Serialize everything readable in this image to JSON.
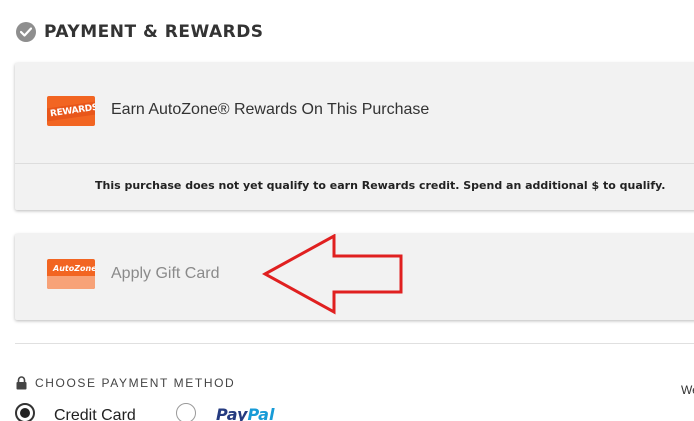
{
  "section": {
    "title": "PAYMENT & REWARDS"
  },
  "rewards": {
    "logo_text": "REWARDS",
    "title": "Earn AutoZone® Rewards On This Purchase",
    "note": "This purchase does not yet qualify to earn Rewards credit. Spend an additional $ to qualify."
  },
  "gift_card": {
    "logo_text": "AutoZone",
    "label": "Apply Gift Card"
  },
  "payment_method": {
    "header": "CHOOSE PAYMENT METHOD",
    "right_text": "We",
    "options": [
      {
        "label": "Credit Card",
        "selected": true
      },
      {
        "label": "PayPal",
        "pay": "Pay",
        "pal": "Pal",
        "selected": false
      }
    ]
  },
  "colors": {
    "brand_orange": "#f26522",
    "annotation_red": "#e02020",
    "paypal_dark": "#253b80",
    "paypal_light": "#179bd7"
  }
}
